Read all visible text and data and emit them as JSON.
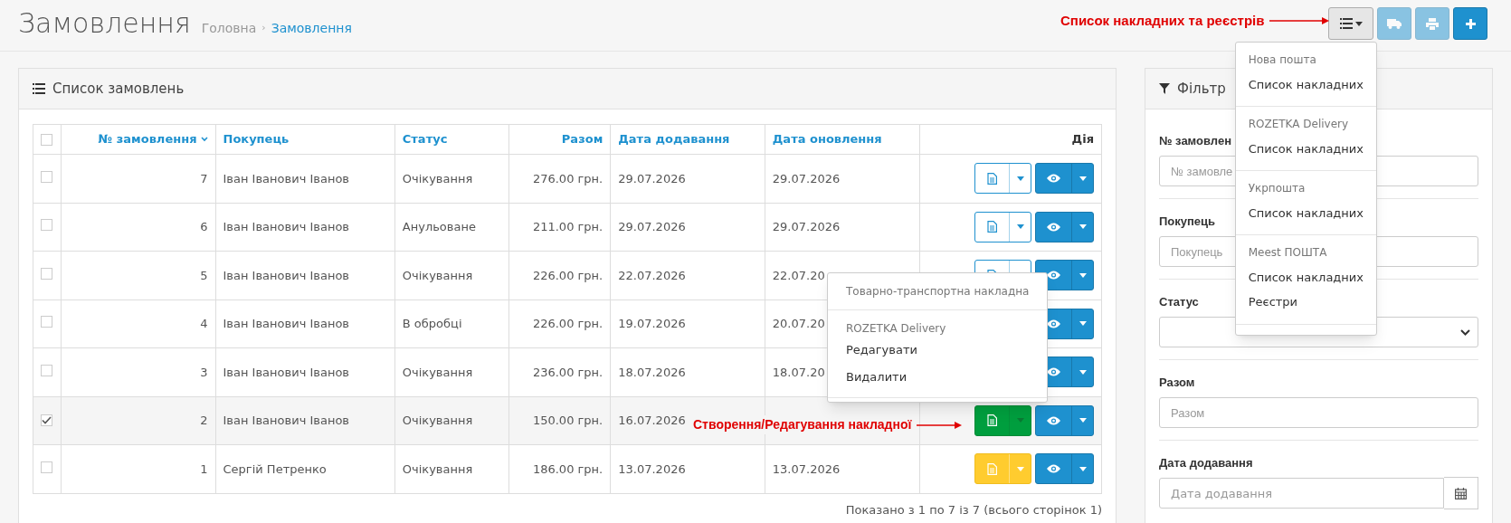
{
  "page": {
    "title": "Замовлення",
    "breadcrumbs": [
      {
        "label": "Головна",
        "selected": false
      },
      {
        "label": "Замовлення",
        "selected": true
      }
    ],
    "separator": "›"
  },
  "toolbar": {
    "annotation": "Список накладних та реєстрів",
    "buttons": [
      {
        "kind": "list",
        "disabled": false
      },
      {
        "kind": "truck",
        "disabled": true
      },
      {
        "kind": "print",
        "disabled": true
      },
      {
        "kind": "add",
        "disabled": false
      }
    ]
  },
  "waybill_menu": {
    "groups": [
      {
        "header": "Нова пошта",
        "items": [
          "Список накладних"
        ]
      },
      {
        "header": "ROZETKA Delivery",
        "items": [
          "Список накладних"
        ]
      },
      {
        "header": "Укрпошта",
        "items": [
          "Список накладних"
        ]
      },
      {
        "header": "Meest ПОШТА",
        "items": [
          "Список накладних",
          "Реєстри"
        ]
      }
    ]
  },
  "orders": {
    "title": "Список замовлень",
    "columns": [
      {
        "label": "№ замовлення",
        "sorted": true
      },
      {
        "label": "Покупець",
        "sorted": false
      },
      {
        "label": "Статус",
        "sorted": false
      },
      {
        "label": "Разом",
        "sorted": false
      },
      {
        "label": "Дата додавання",
        "sorted": false
      },
      {
        "label": "Дата оновлення",
        "sorted": false
      },
      {
        "label": "Дія",
        "sorted": false
      }
    ],
    "select_all": {
      "checked": false
    },
    "rows": [
      {
        "id": "7",
        "customer": "Іван Іванович Іванов",
        "status": "Очікування",
        "total": "276.00 грн.",
        "added": "29.07.2026",
        "updated": "29.07.2026",
        "selected": false,
        "kind": "none"
      },
      {
        "id": "6",
        "customer": "Іван Іванович Іванов",
        "status": "Анульоване",
        "total": "211.00 грн.",
        "added": "29.07.2026",
        "updated": "29.07.2026",
        "selected": false,
        "kind": "none"
      },
      {
        "id": "5",
        "customer": "Іван Іванович Іванов",
        "status": "Очікування",
        "total": "226.00 грн.",
        "added": "22.07.2026",
        "updated": "22.07.20",
        "selected": false,
        "kind": "none"
      },
      {
        "id": "4",
        "customer": "Іван Іванович Іванов",
        "status": "В обробці",
        "total": "226.00 грн.",
        "added": "19.07.2026",
        "updated": "20.07.20",
        "selected": false
      },
      {
        "id": "3",
        "customer": "Іван Іванович Іванов",
        "status": "Очікування",
        "total": "236.00 грн.",
        "added": "18.07.2026",
        "updated": "18.07.20",
        "selected": false
      },
      {
        "id": "2",
        "customer": "Іван Іванович Іванов",
        "status": "Очікування",
        "total": "150.00 грн.",
        "added": "16.07.2026",
        "selected": true,
        "kind": "created"
      },
      {
        "id": "1",
        "customer": "Сергій Петренко",
        "status": "Очікування",
        "total": "186.00 грн.",
        "added": "13.07.2026",
        "updated": "13.07.2026",
        "selected": false,
        "kind": "draft"
      }
    ],
    "row_annotation": "Створення/Редагування накладної",
    "pagination": "Показано з 1 по 7 із 7 (всього сторінок 1)"
  },
  "row_menu": {
    "title": "Товарно-транспортна накладна",
    "header": "ROZETKA Delivery",
    "items": [
      "Редагувати",
      "Видалити"
    ]
  },
  "filter": {
    "title": "Фільтр",
    "fields": [
      {
        "kind": "text",
        "label": "№ замовлен",
        "placeholder": "№ замовле"
      },
      {
        "kind": "text",
        "label": "Покупець",
        "placeholder": "Покупець"
      },
      {
        "kind": "select",
        "label": "Статус"
      },
      {
        "kind": "text",
        "label": "Разом",
        "placeholder": "Разом"
      },
      {
        "kind": "date",
        "label": "Дата додавання",
        "placeholder": "Дата додавання"
      }
    ]
  }
}
